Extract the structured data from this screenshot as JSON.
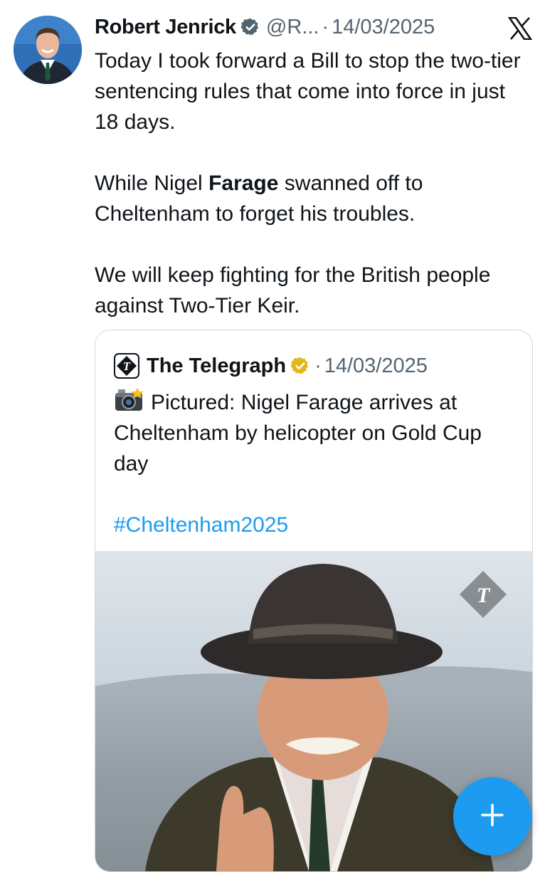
{
  "tweet": {
    "author_name": "Robert Jenrick",
    "handle": "@R...",
    "separator": "·",
    "date": "14/03/2025",
    "paragraphs": {
      "p1": "Today I took forward a Bill to stop the two-tier sentencing rules that come into force in just 18 days.",
      "p2_before": "While Nigel ",
      "p2_bold": "Farage",
      "p2_after": " swanned off to Cheltenham to forget his troubles.",
      "p3": "We will keep fighting for the British people against Two-Tier Keir."
    }
  },
  "quote": {
    "author_name": "The Telegraph",
    "separator": "·",
    "date": "14/03/2025",
    "text": "Pictured: Nigel Farage arrives at Cheltenham by helicopter on Gold Cup day",
    "hashtag": "#Cheltenham2025",
    "media_watermark": "T"
  },
  "icons": {
    "verified": "verified-badge-icon",
    "gold_verified": "gold-verified-badge-icon",
    "x_logo": "x-logo-icon",
    "camera": "camera-flash-emoji-icon",
    "compose": "plus-icon"
  },
  "colors": {
    "accent": "#1d9bf0",
    "secondary_text": "#536471",
    "gold_badge": "#e2b719",
    "border": "#cfd9de"
  }
}
